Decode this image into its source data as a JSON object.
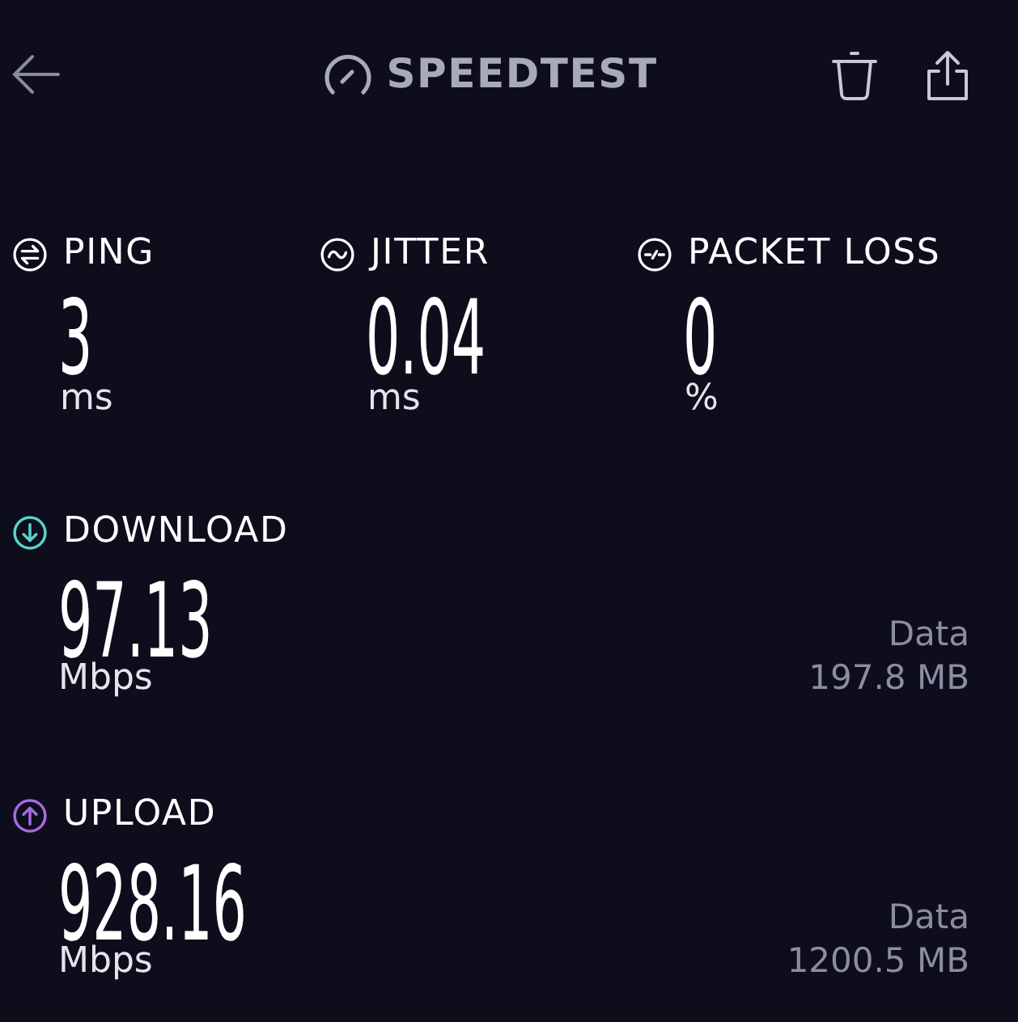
{
  "header": {
    "title": "SPEEDTEST"
  },
  "metrics": [
    {
      "kind": "ping",
      "label": "PING",
      "value": "3",
      "unit": "ms"
    },
    {
      "kind": "jitter",
      "label": "JITTER",
      "value": "0.04",
      "unit": "ms"
    },
    {
      "kind": "packet_loss",
      "label": "PACKET LOSS",
      "value": "0",
      "unit": "%"
    }
  ],
  "results": [
    {
      "kind": "download",
      "label": "DOWNLOAD",
      "color": "#5ad2cc",
      "value": "97.13",
      "unit": "Mbps",
      "data_label": "Data",
      "data_value": "197.8 MB"
    },
    {
      "kind": "upload",
      "label": "UPLOAD",
      "color": "#a86ae0",
      "value": "928.16",
      "unit": "Mbps",
      "data_label": "Data",
      "data_value": "1200.5 MB"
    }
  ]
}
